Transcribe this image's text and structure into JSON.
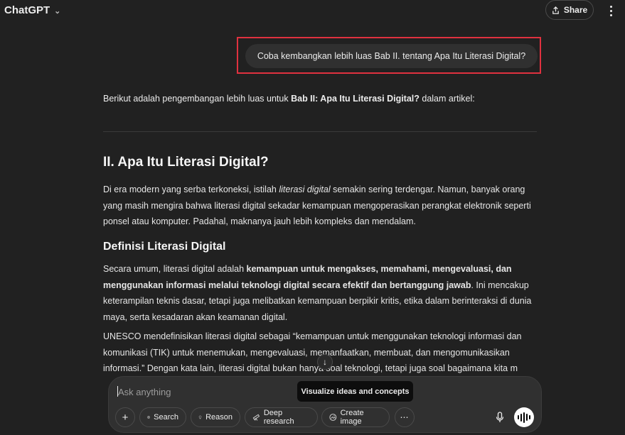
{
  "header": {
    "app_title": "ChatGPT",
    "share_label": "Share"
  },
  "user_message": "Coba kembangkan lebih luas Bab II. tentang Apa Itu Literasi Digital?",
  "assistant": {
    "intro_pre": "Berikut adalah pengembangan lebih luas untuk ",
    "intro_bold": "Bab II: Apa Itu Literasi Digital?",
    "intro_post": " dalam artikel:",
    "heading": "II. Apa Itu Literasi Digital?",
    "p1_pre": "Di era modern yang serba terkoneksi, istilah ",
    "p1_italic": "literasi digital",
    "p1_post": " semakin sering terdengar. Namun, banyak orang yang masih mengira bahwa literasi digital sekadar kemampuan mengoperasikan perangkat elektronik seperti ponsel atau komputer. Padahal, maknanya jauh lebih kompleks dan mendalam.",
    "subheading": "Definisi Literasi Digital",
    "p2_pre": "Secara umum, literasi digital adalah ",
    "p2_bold": "kemampuan untuk mengakses, memahami, mengevaluasi, dan menggunakan informasi melalui teknologi digital secara efektif dan bertanggung jawab",
    "p2_post": ". Ini mencakup keterampilan teknis dasar, tetapi juga melibatkan kemampuan berpikir kritis, etika dalam berinteraksi di dunia maya, serta kesadaran akan keamanan digital.",
    "p3": "UNESCO mendefinisikan literasi digital sebagai “kemampuan untuk menggunakan teknologi informasi dan komunikasi (TIK) untuk menemukan, mengevaluasi, memanfaatkan, membuat, dan mengomunikasikan informasi.” Dengan kata lain, literasi digital bukan hanya soal teknologi, tetapi juga soal bagaimana kita m"
  },
  "composer": {
    "placeholder": "Ask anything",
    "tooltip": "Visualize ideas and concepts",
    "tools": {
      "search": "Search",
      "reason": "Reason",
      "deep_research": "Deep research",
      "create_image": "Create image"
    }
  },
  "icons": {
    "chevron": "chevron-down-icon",
    "share": "share-icon",
    "more": "kebab-menu-icon",
    "scroll": "arrow-down-icon",
    "plus": "plus-icon",
    "globe": "globe-icon",
    "bulb": "lightbulb-icon",
    "telescope": "telescope-icon",
    "image": "image-icon",
    "ellipsis": "ellipsis-icon",
    "mic": "microphone-icon",
    "voice": "voice-mode-icon"
  }
}
